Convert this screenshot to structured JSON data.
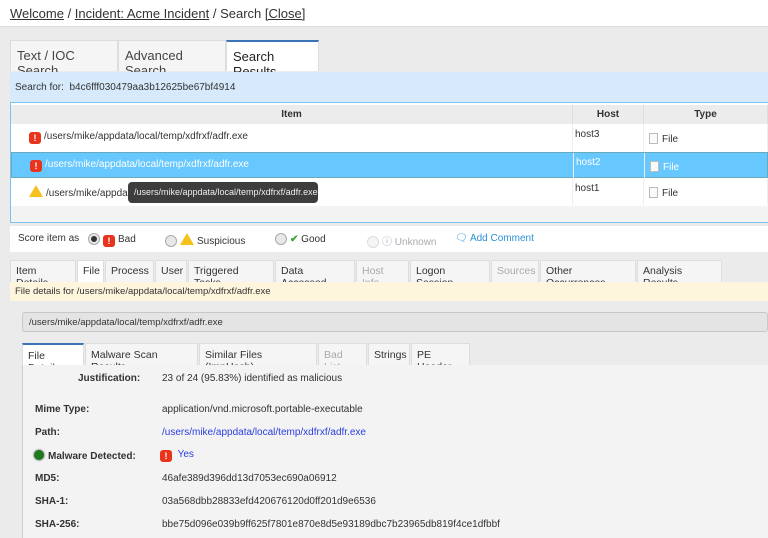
{
  "breadcrumb": {
    "items": [
      "Welcome",
      "Incident: Acme Incident"
    ],
    "current": "Search",
    "close": "[Close]"
  },
  "search_tabs": [
    "Text / IOC Search",
    "Advanced Search",
    "Search Results"
  ],
  "search_for": {
    "label": "Search for:",
    "value": "b4c6fff030479aa3b12625be67bf4914"
  },
  "grid": {
    "columns": [
      "Item",
      "Host",
      "Type"
    ],
    "rows": [
      {
        "icon": "bad-icon",
        "item": "/users/mike/appdata/local/temp/xdfrxf/adfr.exe",
        "host": "host3",
        "type": "File"
      },
      {
        "icon": "bad-icon",
        "item": "/users/mike/appdata/local/temp/xdfrxf/adfr.exe",
        "host": "host2",
        "type": "File",
        "selected": true
      },
      {
        "icon": "warning-icon",
        "item": "/users/mike/appdata/local/temp/xdfrxf/adfr.exe",
        "host": "host1",
        "type": "File"
      }
    ],
    "tooltip": "/users/mike/appdata/local/temp/xdfrxf/adfr.exe"
  },
  "score": {
    "label": "Score item as",
    "options": [
      "Bad",
      "Suspicious",
      "Good",
      "Unknown"
    ],
    "selected": "Bad",
    "add_comment": "Add Comment"
  },
  "detail_tabs": [
    "Item Details",
    "File",
    "Process",
    "User",
    "Triggered Tasks",
    "Data Accessed",
    "Host Info",
    "Logon Session",
    "Sources",
    "Other Occurrences",
    "Analysis Results"
  ],
  "file_details_header": "File details for /users/mike/appdata/local/temp/xdfrxf/adfr.exe",
  "path_bar": "/users/mike/appdata/local/temp/xdfrxf/adfr.exe",
  "file_tabs": [
    "File Details",
    "Malware Scan Results",
    "Similar Files (ImpHash)",
    "Bad List",
    "Strings",
    "PE Header"
  ],
  "fields": {
    "justification": {
      "label": "Justification:",
      "value": "23 of 24 (95.83%) identified as malicious"
    },
    "mime": {
      "label": "Mime Type:",
      "value": "application/vnd.microsoft.portable-executable"
    },
    "path": {
      "label": "Path:",
      "value": "/users/mike/appdata/local/temp/xdfrxf/adfr.exe"
    },
    "malware": {
      "label": "Malware Detected:",
      "value": "Yes"
    },
    "md5": {
      "label": "MD5:",
      "value": "46afe389d396dd13d7053ec690a06912"
    },
    "sha1": {
      "label": "SHA-1:",
      "value": "03a568dbb28833efd420676120d0ff201d9e6536"
    },
    "sha256": {
      "label": "SHA-256:",
      "value": "bbe75d096e039b9ff625f7801e870e8d5e93189dbc7b23965db819f4ce1dfbbf"
    }
  },
  "colors": {
    "accent": "#3b73b9",
    "selected_row": "#66c8fe",
    "search_bar": "#d6eafb",
    "bad": "#e8341c",
    "warning": "#f4c21b"
  }
}
